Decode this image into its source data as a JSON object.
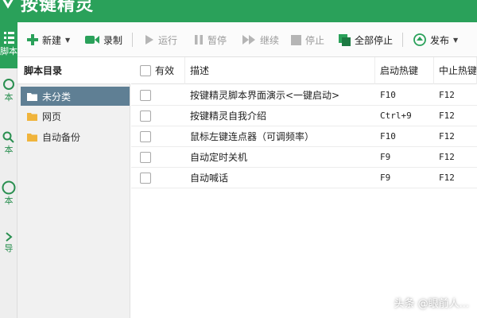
{
  "app": {
    "title": "按键精灵"
  },
  "rail": {
    "items": [
      {
        "label": "脚本",
        "icon": "list-icon",
        "active": true
      },
      {
        "label": "本",
        "icon": "bookmark-icon"
      },
      {
        "label": "本",
        "icon": "search-icon"
      },
      {
        "label": "本",
        "icon": "clock-icon"
      },
      {
        "label": "导",
        "icon": "chevron-right-icon"
      }
    ]
  },
  "toolbar": {
    "new_label": "新建",
    "record_label": "录制",
    "run_label": "运行",
    "pause_label": "暂停",
    "continue_label": "继续",
    "stop_label": "停止",
    "stop_all_label": "全部停止",
    "publish_label": "发布"
  },
  "sidebar": {
    "header": "脚本目录",
    "items": [
      {
        "label": "未分类",
        "selected": true
      },
      {
        "label": "网页"
      },
      {
        "label": "自动备份"
      }
    ]
  },
  "table": {
    "columns": [
      "有效",
      "描述",
      "启动热键",
      "中止热键"
    ],
    "rows": [
      {
        "desc": "按键精灵脚本界面演示<一键启动>",
        "start": "F10",
        "stop": "F12"
      },
      {
        "desc": "按键精灵自我介绍",
        "start": "Ctrl+9",
        "stop": "F12"
      },
      {
        "desc": "鼠标左键连点器（可调频率）",
        "start": "F10",
        "stop": "F12"
      },
      {
        "desc": "自动定时关机",
        "start": "F9",
        "stop": "F12"
      },
      {
        "desc": "自动喊话",
        "start": "F9",
        "stop": "F12"
      }
    ]
  },
  "watermark": "头条 @眼前人...",
  "colors": {
    "accent": "#2aa15a",
    "selection": "#5f7f94",
    "folder": "#f0b43c"
  }
}
